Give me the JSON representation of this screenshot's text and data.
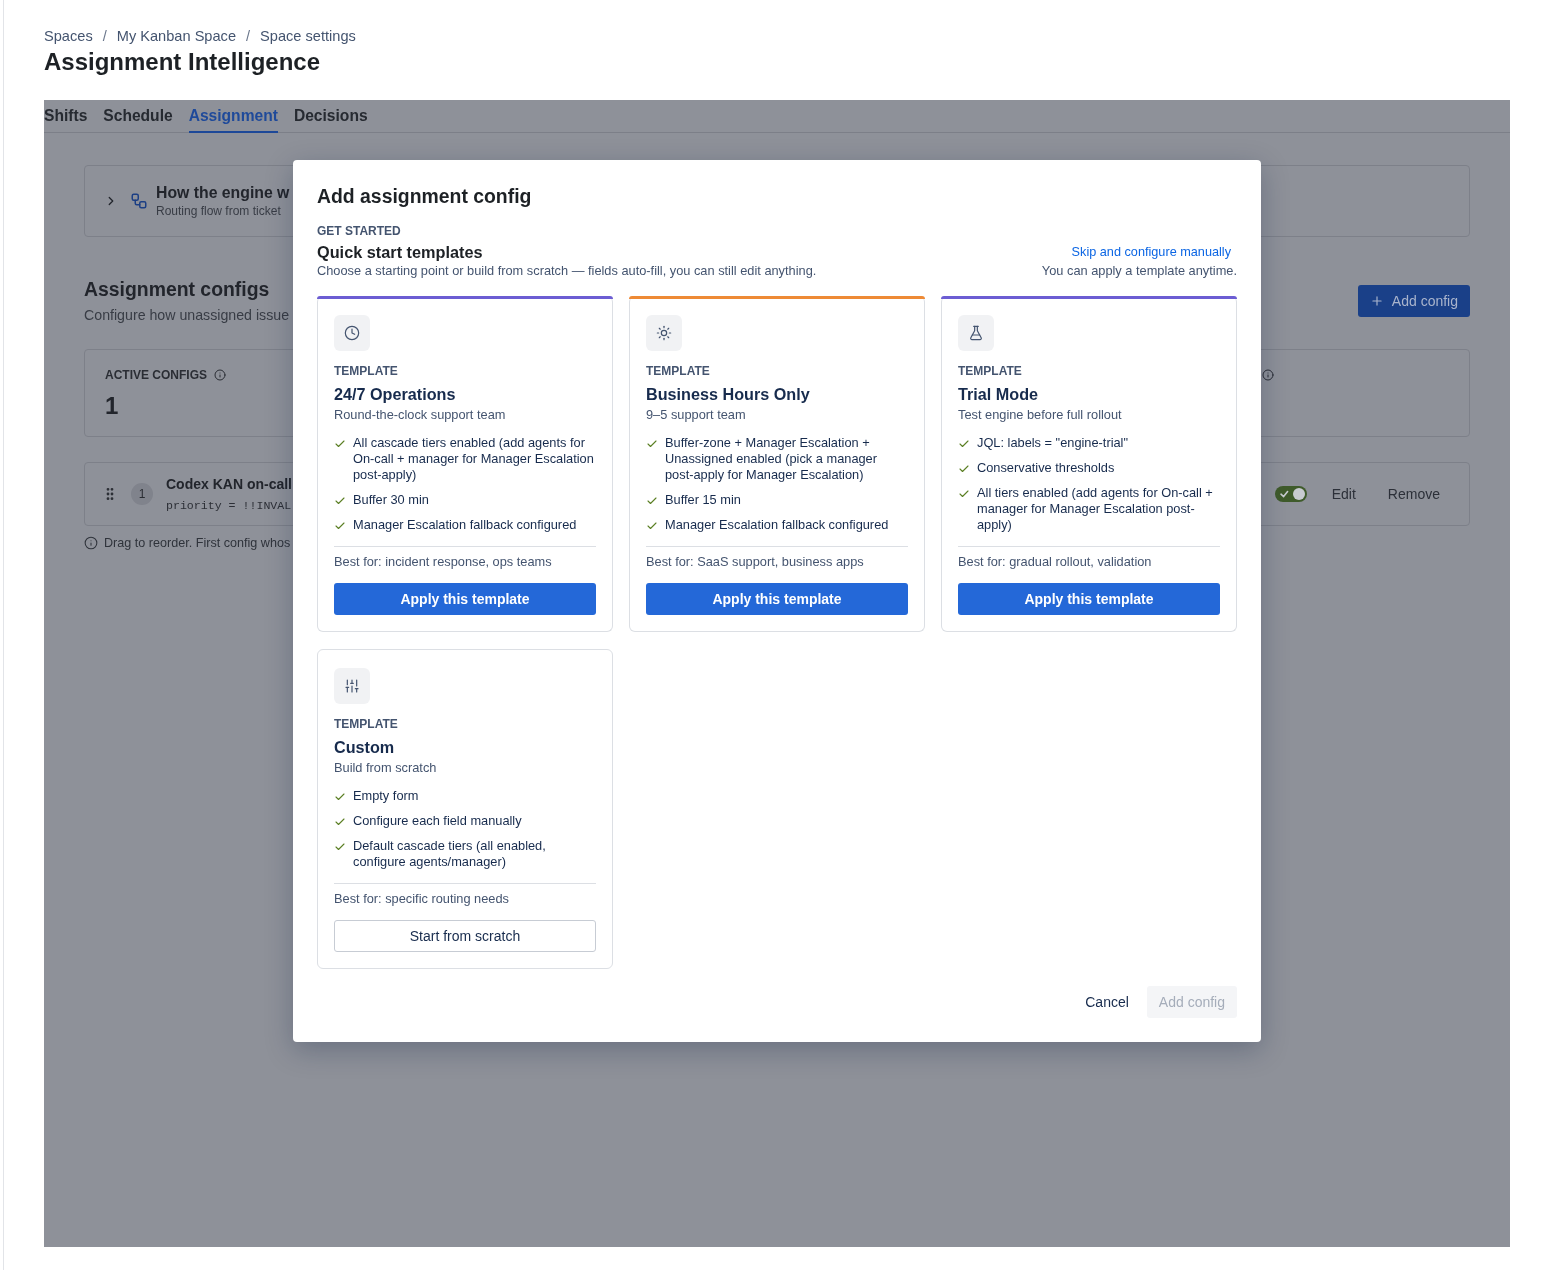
{
  "breadcrumb": {
    "items": [
      "Spaces",
      "My Kanban Space",
      "Space settings"
    ],
    "separator": "/"
  },
  "page_title": "Assignment Intelligence",
  "tabs": [
    {
      "label": "Shifts",
      "selected": false
    },
    {
      "label": "Schedule",
      "selected": false
    },
    {
      "label": "Assignment",
      "selected": true
    },
    {
      "label": "Decisions",
      "selected": false
    }
  ],
  "engine_panel": {
    "title": "How the engine w",
    "subtitle": "Routing flow from ticket",
    "expanded": false
  },
  "configs_section": {
    "title": "Assignment configs",
    "description": "Configure how unassigned issue",
    "add_button": "Add config"
  },
  "stats": [
    {
      "label": "ACTIVE CONFIGS",
      "value": "1"
    }
  ],
  "config_rows": [
    {
      "order": "1",
      "name": "Codex KAN on-call",
      "query": "priority = !!INVAL",
      "enabled": true,
      "actions": [
        "Edit",
        "Remove"
      ]
    }
  ],
  "reorder_hint": "Drag to reorder. First config whos",
  "dialog": {
    "title": "Add assignment config",
    "eyebrow": "GET STARTED",
    "heading": "Quick start templates",
    "description": "Choose a starting point or build from scratch — fields auto-fill, you can still edit anything.",
    "skip_link": "Skip and configure manually",
    "skip_note": "You can apply a template anytime.",
    "templates": [
      {
        "eyebrow": "TEMPLATE",
        "name": "24/7 Operations",
        "subtitle": "Round-the-clock support team",
        "color": "#6c5dd3",
        "features": [
          "All cascade tiers enabled (add agents for On-call + manager for Manager Escalation post-apply)",
          "Buffer 30 min",
          "Manager Escalation fallback configured"
        ],
        "best_for": "Best for: incident response, ops teams",
        "button": {
          "label": "Apply this template",
          "kind": "primary"
        }
      },
      {
        "eyebrow": "TEMPLATE",
        "name": "Business Hours Only",
        "subtitle": "9–5 support team",
        "color": "#ee8a35",
        "features": [
          "Buffer-zone + Manager Escalation + Unassigned enabled (pick a manager post-apply for Manager Escalation)",
          "Buffer 15 min",
          "Manager Escalation fallback configured"
        ],
        "best_for": "Best for: SaaS support, business apps",
        "button": {
          "label": "Apply this template",
          "kind": "primary"
        }
      },
      {
        "eyebrow": "TEMPLATE",
        "name": "Trial Mode",
        "subtitle": "Test engine before full rollout",
        "color": "#6c5dd3",
        "features": [
          "JQL: labels = \"engine-trial\"",
          "Conservative thresholds",
          "All tiers enabled (add agents for On-call + manager for Manager Escalation post-apply)"
        ],
        "best_for": "Best for: gradual rollout, validation",
        "button": {
          "label": "Apply this template",
          "kind": "primary"
        }
      },
      {
        "eyebrow": "TEMPLATE",
        "name": "Custom",
        "subtitle": "Build from scratch",
        "features": [
          "Empty form",
          "Configure each field manually",
          "Default cascade tiers (all enabled, configure agents/manager)"
        ],
        "best_for": "Best for: specific routing needs",
        "button": {
          "label": "Start from scratch",
          "kind": "secondary"
        }
      }
    ],
    "footer_buttons": [
      {
        "label": "Cancel",
        "kind": "subtle",
        "disabled": false
      },
      {
        "label": "Add config",
        "kind": "primary",
        "disabled": true
      }
    ]
  }
}
